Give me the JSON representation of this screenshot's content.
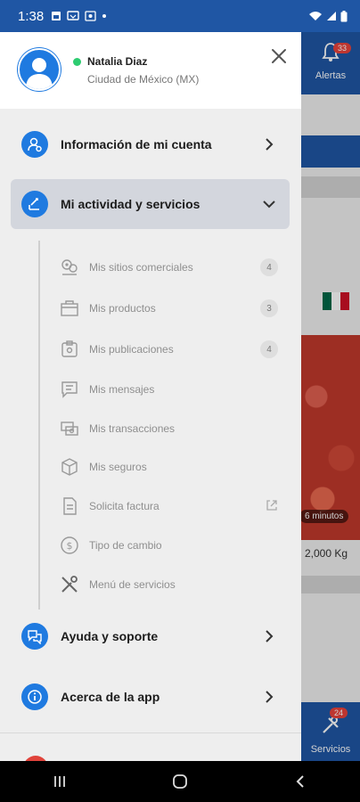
{
  "status_bar": {
    "time": "1:38",
    "icons": [
      "image-icon",
      "cast-icon",
      "screenshot-icon",
      "dot-icon"
    ],
    "right_icons": [
      "wifi-icon",
      "signal-icon",
      "battery-icon"
    ]
  },
  "background_app": {
    "alerts_label": "Alertas",
    "alerts_count": "33",
    "card_time_label": "6 minutos",
    "card_weight": "2,000 Kg",
    "services_label": "Servicios",
    "services_count": "24",
    "flag_colors": [
      "#006847",
      "#ffffff",
      "#ce1126"
    ]
  },
  "profile": {
    "name": "Natalia Diaz",
    "location": "Ciudad de México (MX)",
    "online": true
  },
  "menu": {
    "account": {
      "label": "Información de mi cuenta",
      "icon": "user-gear-icon"
    },
    "activity": {
      "label": "Mi actividad y servicios",
      "icon": "activity-icon",
      "expanded": true
    },
    "help": {
      "label": "Ayuda y soporte",
      "icon": "chat-help-icon"
    },
    "about": {
      "label": "Acerca de la app",
      "icon": "info-icon"
    }
  },
  "submenu": [
    {
      "label": "Mis sitios comerciales",
      "icon": "location-pins-icon",
      "count": "4"
    },
    {
      "label": "Mis productos",
      "icon": "box-icon",
      "count": "3"
    },
    {
      "label": "Mis publicaciones",
      "icon": "publication-icon",
      "count": "4"
    },
    {
      "label": "Mis mensajes",
      "icon": "message-icon"
    },
    {
      "label": "Mis transacciones",
      "icon": "transactions-icon"
    },
    {
      "label": "Mis seguros",
      "icon": "insurance-icon"
    },
    {
      "label": "Solicita factura",
      "icon": "invoice-icon",
      "external": true
    },
    {
      "label": "Tipo de cambio",
      "icon": "exchange-icon"
    },
    {
      "label": "Menú de servicios",
      "icon": "tools-icon"
    }
  ],
  "colors": {
    "primary": "#1f56a4",
    "accent": "#1f7ae0",
    "online": "#2ecc71",
    "badge": "#e8433b"
  }
}
